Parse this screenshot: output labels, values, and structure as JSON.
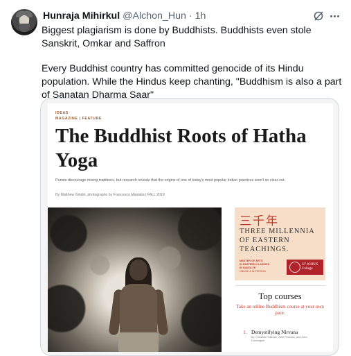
{
  "tweet": {
    "display_name": "Hunraja Mihirkul",
    "handle": "@Alchon_Hun",
    "dot": "·",
    "time": "1h",
    "avatar_icon": "avatar-portrait",
    "grok_icon": "grok-icon",
    "more_icon": "more-icon",
    "text": [
      "Biggest plagiarism is done by Buddhists. Buddhists even stole Sanskrit, Omkar and Saffron",
      "Every Buddhist country has committed genocide of its Hindu population. While the Hindus keep chanting, \"Buddhism is also a part of Sanatan Dharma Saar\""
    ]
  },
  "article": {
    "breadcrumb_1": "IDEAS",
    "breadcrumb_2": "MAGAZINE | FEATURE",
    "headline": "The Buddhist Roots of Hatha Yoga",
    "dek": "Purists discourage mixing traditions, but research reveals that the origins of one of today's most popular Indian practices aren't so clear-cut.",
    "byline": "By Matthew Gindin, photographs by Francesco Mastalia  |  FALL 2019"
  },
  "ad": {
    "chars": "三千年",
    "line1": "THREE MILLENNIA",
    "line2": "OF EASTERN",
    "line3": "TEACHINGS.",
    "small": "MASTER OF ARTS\nIN EASTERN CLASSICS\nIN SANTA FE",
    "small2": "ONLINE & IN-PERSON",
    "logo": "ST JOHN'S\nCollege",
    "accent": "#c0392b",
    "background": "#f6dec8"
  },
  "courses": {
    "title": "Top courses",
    "subtitle": "Take an online Buddhism course at your own pace.",
    "items": [
      {
        "num": "1.",
        "name": "Demystifying Nirvana",
        "by": "by: Christine Feldman, John Peacock, and John Dunnington"
      }
    ]
  },
  "colors": {
    "text_primary": "#0f1419",
    "text_secondary": "#536471",
    "border": "#cfd9de"
  }
}
